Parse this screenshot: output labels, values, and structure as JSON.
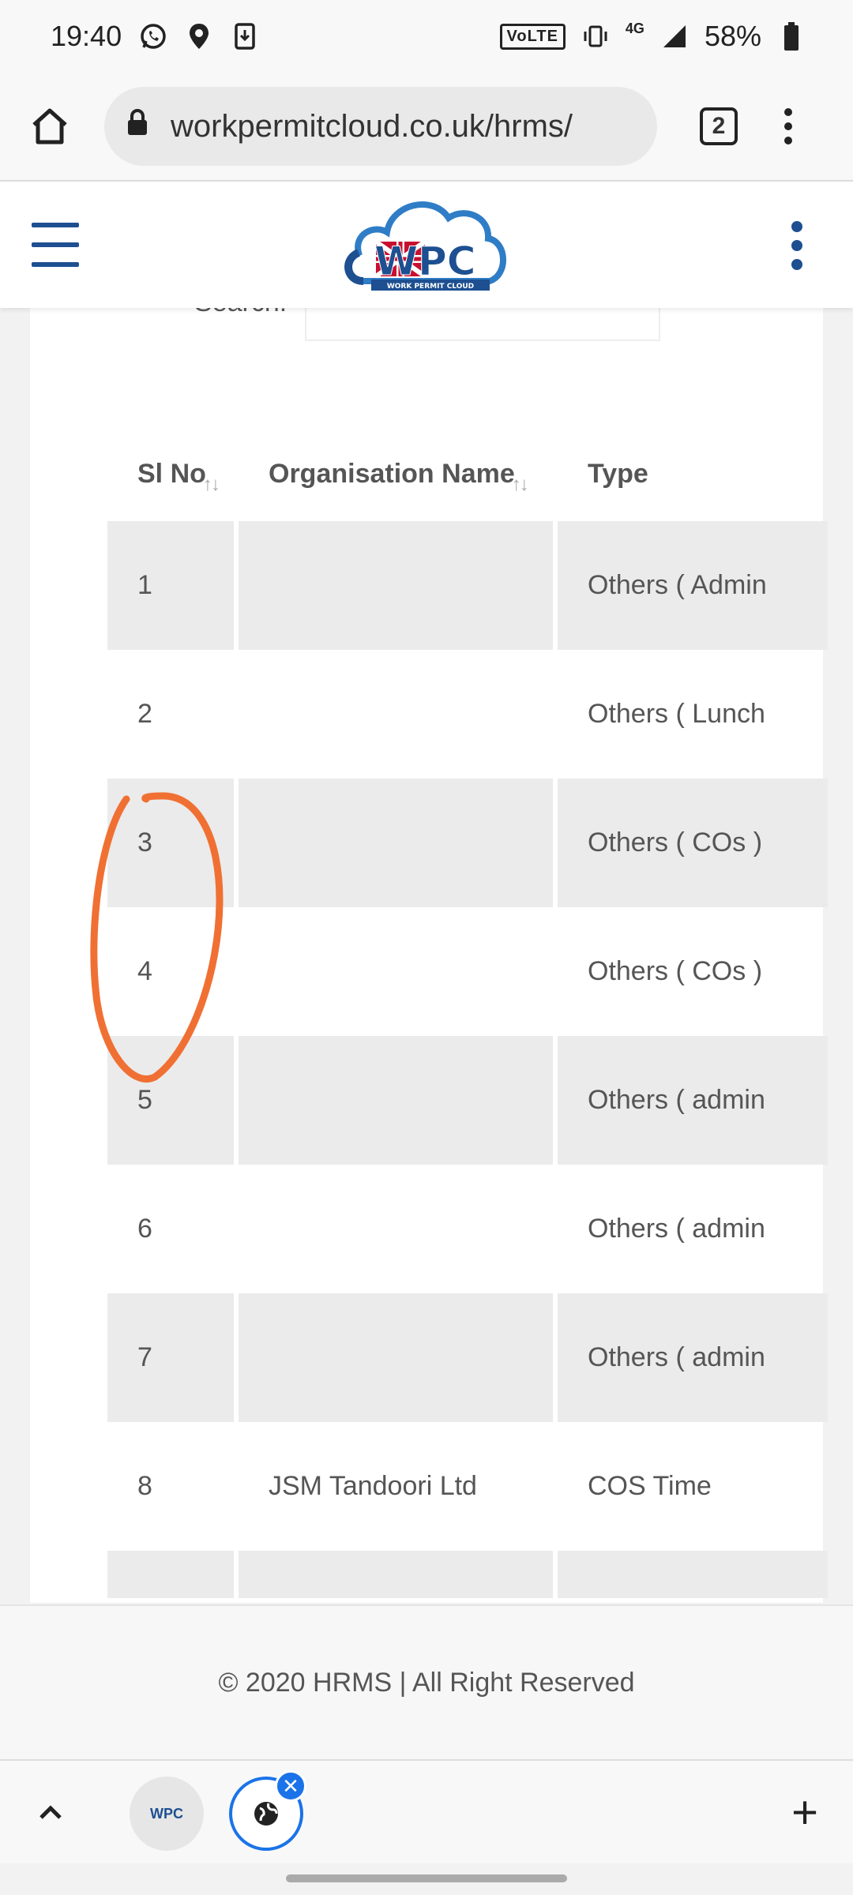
{
  "status_bar": {
    "time": "19:40",
    "volte": "VoLTE",
    "network": "4G",
    "battery": "58%"
  },
  "browser": {
    "url": "workpermitcloud.co.uk/hrms/",
    "tab_count": "2"
  },
  "header": {
    "logo_text": "WPC",
    "logo_subtext": "WORK PERMIT CLOUD",
    "brand_color": "#1d4f91"
  },
  "search": {
    "label": "Search:",
    "value": ""
  },
  "table": {
    "columns": [
      "Sl No",
      "Organisation Name",
      "Type"
    ],
    "rows": [
      {
        "sl": "1",
        "org": "",
        "type": "Others ( Admin"
      },
      {
        "sl": "2",
        "org": "",
        "type": "Others ( Lunch"
      },
      {
        "sl": "3",
        "org": "",
        "type": "Others ( COs )"
      },
      {
        "sl": "4",
        "org": "",
        "type": "Others ( COs )"
      },
      {
        "sl": "5",
        "org": "",
        "type": "Others ( admin"
      },
      {
        "sl": "6",
        "org": "",
        "type": "Others ( admin"
      },
      {
        "sl": "7",
        "org": "",
        "type": "Others ( admin"
      },
      {
        "sl": "8",
        "org": "JSM Tandoori Ltd",
        "type": "COS Time"
      }
    ]
  },
  "footer": {
    "copyright": "© 2020 HRMS | All Right Reserved"
  },
  "bottom_bar": {
    "tab1_label": "WPC"
  },
  "colors": {
    "accent": "#1a73e8",
    "annotation": "#f07033",
    "row_shade": "#ebebeb"
  }
}
